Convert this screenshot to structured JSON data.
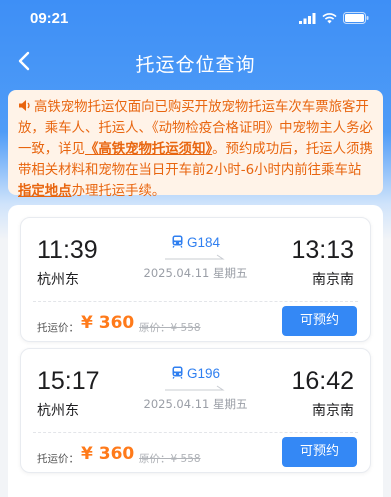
{
  "status_bar": {
    "time": "09:21"
  },
  "nav": {
    "title": "托运仓位查询"
  },
  "notice": {
    "segments": [
      {
        "text": "高铁宠物托运仅面向已购买开放宠物托运车次车票旅客开放，乘车人、托运人、《动物检疫合格证明》中宠物主人务必一致，详见",
        "link": false
      },
      {
        "text": "《高铁宠物托运须知》",
        "link": true
      },
      {
        "text": "。预约成功后，托运人须携带相关材料和宠物在当日开车前2小时-6小时内前往乘车站 ",
        "link": false
      },
      {
        "text": "指定地点",
        "link": true
      },
      {
        "text": "办理托运手续。",
        "link": false
      }
    ]
  },
  "trains": [
    {
      "train_no": "G184",
      "dep_time": "11:39",
      "dep_station": "杭州东",
      "arr_time": "13:13",
      "arr_station": "南京南",
      "date": "2025.04.11 星期五",
      "price_label": "托运价：",
      "price": "¥ 360",
      "orig_price": "原价：¥ 558",
      "book_label": "可预约"
    },
    {
      "train_no": "G196",
      "dep_time": "15:17",
      "dep_station": "杭州东",
      "arr_time": "16:42",
      "arr_station": "南京南",
      "date": "2025.04.11 星期五",
      "price_label": "托运价：",
      "price": "¥ 360",
      "orig_price": "原价：¥ 558",
      "book_label": "可预约"
    }
  ],
  "colors": {
    "brand": "#3488f5",
    "notice_text": "#e8650f",
    "notice_bg": "#fff3e8",
    "price": "#ff7a1a"
  },
  "icons": {
    "back": "chevron-left-icon",
    "speaker": "speaker-icon",
    "train": "train-icon",
    "signal": "signal-icon",
    "wifi": "wifi-icon",
    "battery": "battery-icon"
  }
}
